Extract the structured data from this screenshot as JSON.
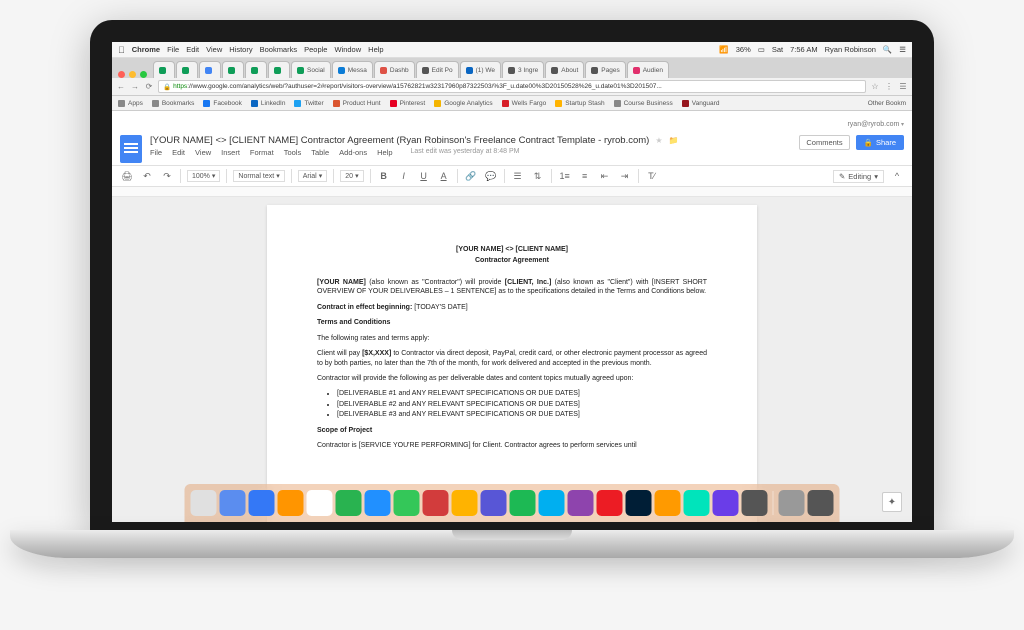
{
  "mac_menubar": {
    "app": "Chrome",
    "left": [
      "File",
      "Edit",
      "View",
      "History",
      "Bookmarks",
      "People",
      "Window",
      "Help"
    ],
    "right": {
      "wifi": "36%",
      "day": "Sat",
      "time": "7:56 AM",
      "user": "Ryan Robinson"
    }
  },
  "chrome": {
    "tabs": [
      {
        "label": "",
        "color": "#0f9d58"
      },
      {
        "label": "",
        "color": "#0f9d58"
      },
      {
        "label": "",
        "color": "#4285f4"
      },
      {
        "label": "",
        "color": "#0f9d58"
      },
      {
        "label": "",
        "color": "#0f9d58"
      },
      {
        "label": "",
        "color": "#0f9d58"
      },
      {
        "label": "Social",
        "color": "#0f9d58"
      },
      {
        "label": "Messa",
        "color": "#0b7cd6"
      },
      {
        "label": "Dashb",
        "color": "#de5246"
      },
      {
        "label": "Edit Po",
        "color": "#555"
      },
      {
        "label": "(1) We",
        "color": "#0a66c2"
      },
      {
        "label": "3 Ingre",
        "color": "#555"
      },
      {
        "label": "About",
        "color": "#555"
      },
      {
        "label": "Pages",
        "color": "#555"
      },
      {
        "label": "Audien",
        "color": "#e1306c"
      }
    ],
    "url_https": "https",
    "url_rest": "://www.google.com/analytics/web/?authuser=2#report/visitors-overview/a15762821w32317960p87322503/%3F_u.date00%3D20150528%26_u.date01%3D201507...",
    "bookmarks": [
      {
        "label": "Apps",
        "color": "#888"
      },
      {
        "label": "Bookmarks",
        "color": "#888"
      },
      {
        "label": "Facebook",
        "color": "#1877f2"
      },
      {
        "label": "LinkedIn",
        "color": "#0a66c2"
      },
      {
        "label": "Twitter",
        "color": "#1da1f2"
      },
      {
        "label": "Product Hunt",
        "color": "#da552f"
      },
      {
        "label": "Pinterest",
        "color": "#e60023"
      },
      {
        "label": "Google Analytics",
        "color": "#f4b400"
      },
      {
        "label": "Wells Fargo",
        "color": "#d71e28"
      },
      {
        "label": "Startup Stash",
        "color": "#ffb300"
      },
      {
        "label": "Course Business",
        "color": "#888"
      },
      {
        "label": "Vanguard",
        "color": "#96151d"
      }
    ],
    "other_bookmarks": "Other Bookm"
  },
  "gdocs": {
    "email": "ryan@ryrob.com",
    "title": "[YOUR NAME] <> [CLIENT NAME] Contractor Agreement (Ryan Robinson's Freelance Contract Template - ryrob.com)",
    "menus": [
      "File",
      "Edit",
      "View",
      "Insert",
      "Format",
      "Tools",
      "Table",
      "Add-ons",
      "Help"
    ],
    "last_edit": "Last edit was yesterday at 8:48 PM",
    "comments": "Comments",
    "share": "Share",
    "toolbar": {
      "zoom": "100%",
      "style": "Normal text",
      "font": "Arial",
      "size": "20",
      "editing": "Editing"
    }
  },
  "document": {
    "heading_line1": "[YOUR NAME] <> [CLIENT NAME]",
    "heading_line2": "Contractor Agreement",
    "p1_a": "[YOUR NAME]",
    "p1_b": " (also known as \"Contractor\") will provide ",
    "p1_c": "[CLIENT, Inc.]",
    "p1_d": " (also known as \"Client\") with [INSERT SHORT OVERVIEW OF YOUR DELIVERABLES – 1 SENTENCE] as to the specifications detailed in the Terms and Conditions below.",
    "p2_a": "Contract in effect beginning:",
    "p2_b": "  [TODAY'S DATE]",
    "h_terms": "Terms and Conditions",
    "p3": "The following rates and terms apply:",
    "p4_a": "Client will pay ",
    "p4_b": "[$X,XXX]",
    "p4_c": " to Contractor via direct deposit, PayPal, credit card, or other electronic payment processor as agreed to by both parties, no later than the 7th of the month, for work delivered and accepted in the previous month.",
    "p5": "Contractor will provide the following as per deliverable dates and content topics mutually agreed upon:",
    "d1": "[DELIVERABLE #1 and ANY RELEVANT SPECIFICATIONS OR DUE DATES]",
    "d2": "[DELIVERABLE #2 and ANY RELEVANT SPECIFICATIONS OR DUE DATES]",
    "d3": "[DELIVERABLE #3 and ANY RELEVANT SPECIFICATIONS OR DUE DATES]",
    "h_scope": "Scope of Project",
    "p6": "Contractor is [SERVICE YOU'RE PERFORMING] for Client. Contractor agrees to perform services until"
  },
  "dock": {
    "items": [
      {
        "c": "#e0e0e0"
      },
      {
        "c": "#5b8def"
      },
      {
        "c": "#3478f6"
      },
      {
        "c": "#ff9500"
      },
      {
        "c": "#ffffff"
      },
      {
        "c": "#29b350"
      },
      {
        "c": "#2190ff"
      },
      {
        "c": "#34c759"
      },
      {
        "c": "#d23c3c"
      },
      {
        "c": "#ffb300"
      },
      {
        "c": "#5856d6"
      },
      {
        "c": "#1db954"
      },
      {
        "c": "#00aff0"
      },
      {
        "c": "#8e44ad"
      },
      {
        "c": "#ec1c24"
      },
      {
        "c": "#001e36"
      },
      {
        "c": "#ff9a00"
      },
      {
        "c": "#00e4bb"
      },
      {
        "c": "#6a3de8"
      },
      {
        "c": "#555"
      }
    ],
    "right": [
      {
        "c": "#999"
      },
      {
        "c": "#555"
      }
    ]
  }
}
